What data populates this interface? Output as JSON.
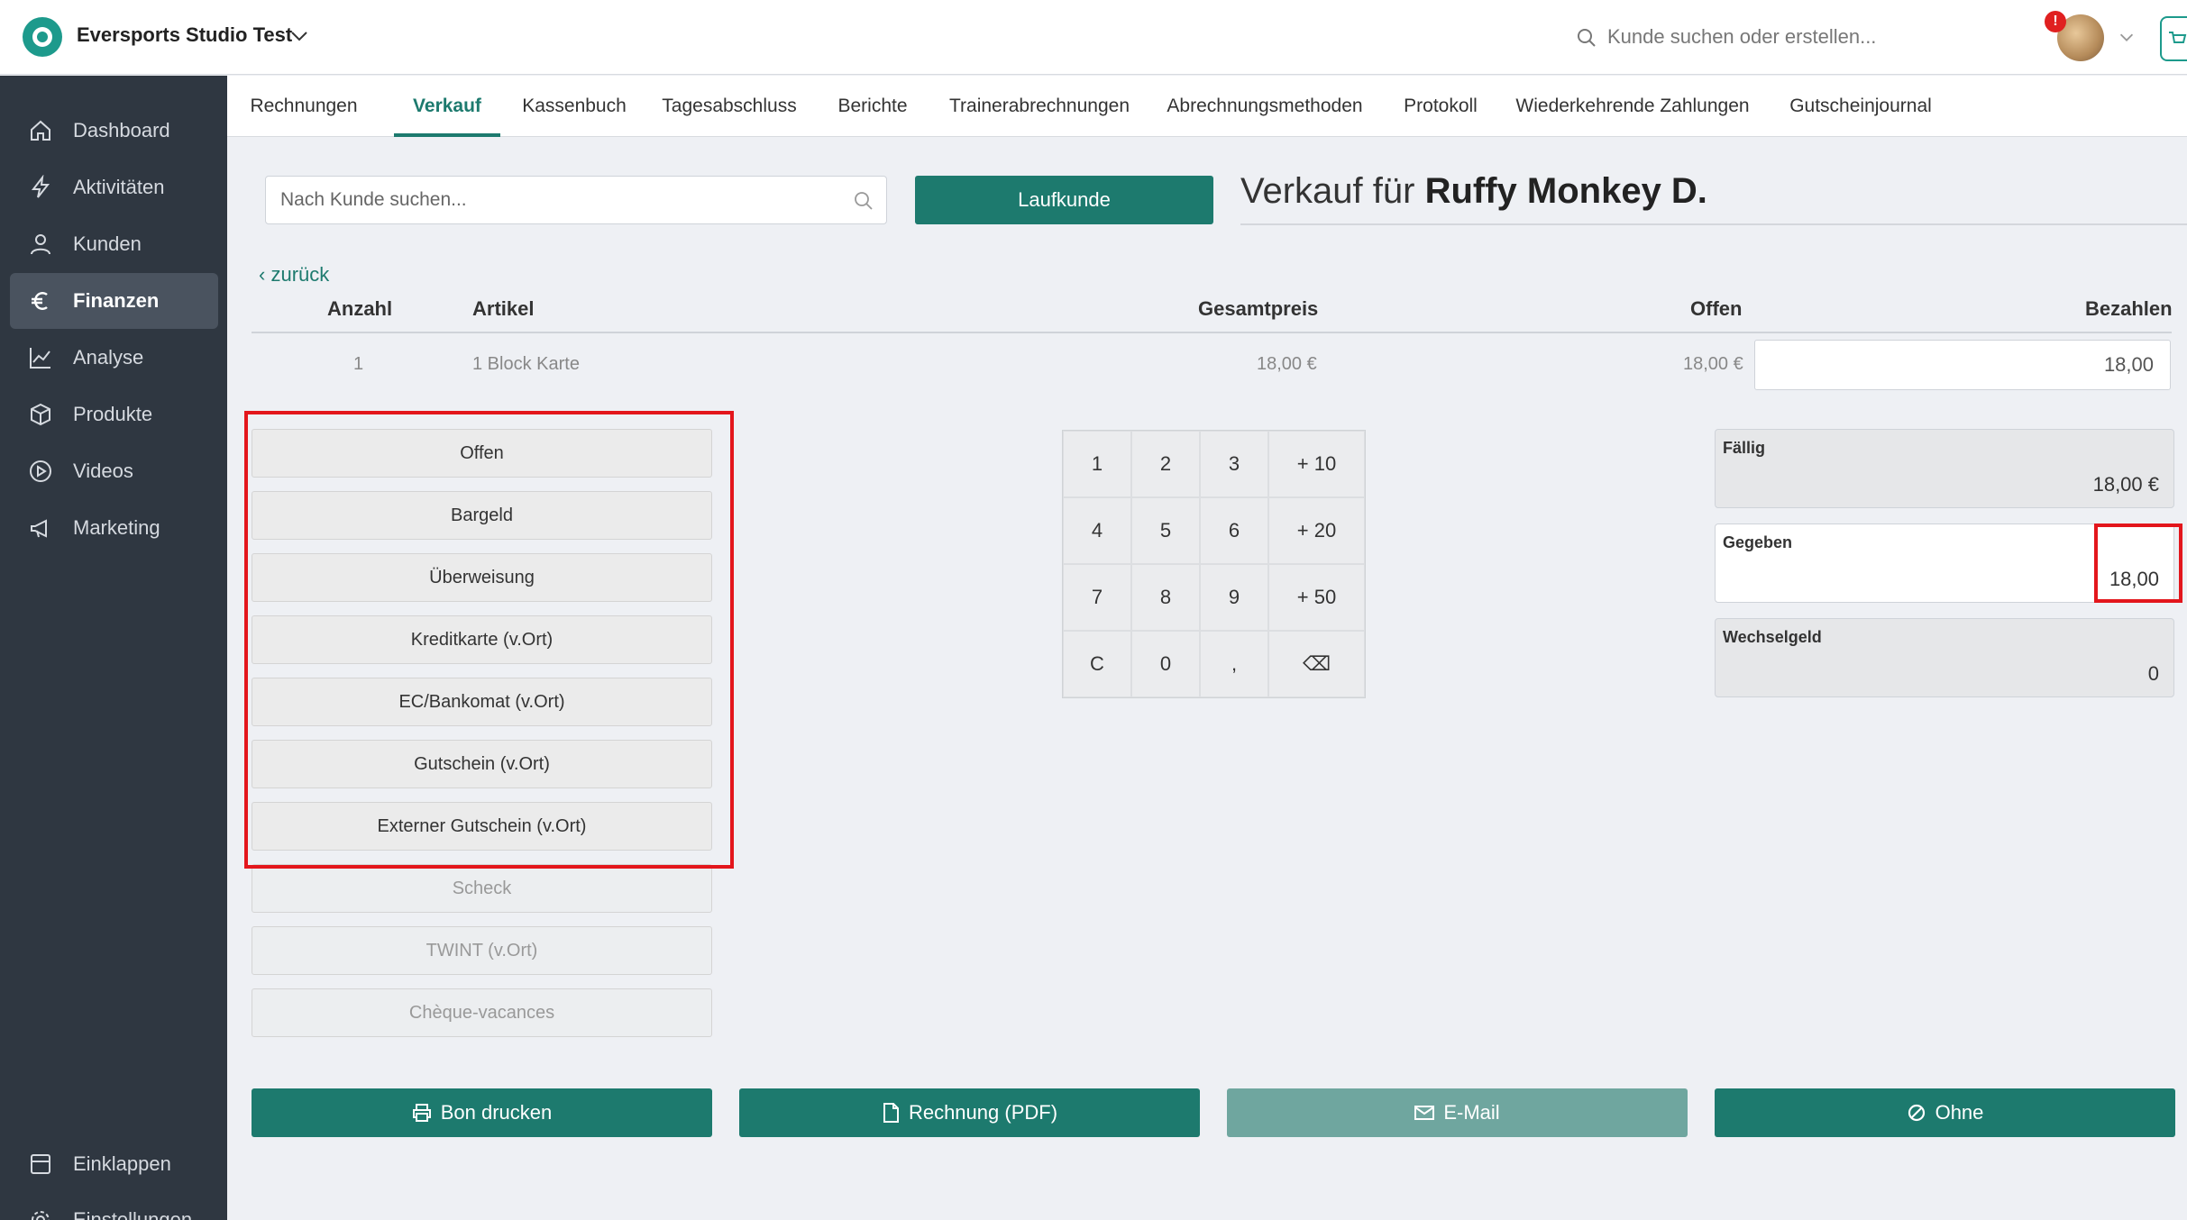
{
  "app": {
    "studio_name": "Eversports Studio Test",
    "search_placeholder": "Kunde suchen oder erstellen...",
    "notification_count": "!"
  },
  "sidebar": {
    "items": [
      {
        "label": "Dashboard",
        "icon": "home-icon"
      },
      {
        "label": "Aktivitäten",
        "icon": "bolt-icon"
      },
      {
        "label": "Kunden",
        "icon": "user-icon"
      },
      {
        "label": "Finanzen",
        "icon": "euro-icon"
      },
      {
        "label": "Analyse",
        "icon": "chart-icon"
      },
      {
        "label": "Produkte",
        "icon": "box-icon"
      },
      {
        "label": "Videos",
        "icon": "play-icon"
      },
      {
        "label": "Marketing",
        "icon": "megaphone-icon"
      }
    ],
    "collapse_label": "Einklappen",
    "settings_label": "Einstellungen"
  },
  "tabs": [
    "Rechnungen",
    "Verkauf",
    "Kassenbuch",
    "Tagesabschluss",
    "Berichte",
    "Trainerabrechnungen",
    "Abrechnungsmethoden",
    "Protokoll",
    "Wiederkehrende Zahlungen",
    "Gutscheinjournal"
  ],
  "sale": {
    "search_placeholder": "Nach Kunde suchen...",
    "walkin_label": "Laufkunde",
    "title_prefix": "Verkauf für",
    "customer_name": "Ruffy Monkey D.",
    "back_label": "zurück"
  },
  "table": {
    "headers": {
      "qty": "Anzahl",
      "item": "Artikel",
      "total": "Gesamtpreis",
      "open": "Offen",
      "pay": "Bezahlen"
    },
    "row": {
      "qty": "1",
      "item": "1 Block Karte",
      "total": "18,00 €",
      "open": "18,00 €",
      "pay": "18,00"
    }
  },
  "payment_methods": [
    "Offen",
    "Bargeld",
    "Überweisung",
    "Kreditkarte (v.Ort)",
    "EC/Bankomat (v.Ort)",
    "Gutschein (v.Ort)",
    "Externer Gutschein (v.Ort)",
    "Scheck",
    "TWINT (v.Ort)",
    "Chèque-vacances"
  ],
  "numpad": {
    "keys": [
      "1",
      "2",
      "3",
      "+ 10",
      "4",
      "5",
      "6",
      "+ 20",
      "7",
      "8",
      "9",
      "+ 50",
      "C",
      "0",
      ",",
      "⌫"
    ]
  },
  "summary": {
    "due_label": "Fällig",
    "due_value": "18,00 €",
    "given_label": "Gegeben",
    "given_value": "18,00",
    "change_label": "Wechselgeld",
    "change_value": "0"
  },
  "actions": {
    "print": "Bon drucken",
    "invoice": "Rechnung (PDF)",
    "email": "E-Mail",
    "none": "Ohne"
  },
  "colors": {
    "accent": "#1d7a6e",
    "sidebar": "#2f3741",
    "highlight": "#e3161c"
  }
}
